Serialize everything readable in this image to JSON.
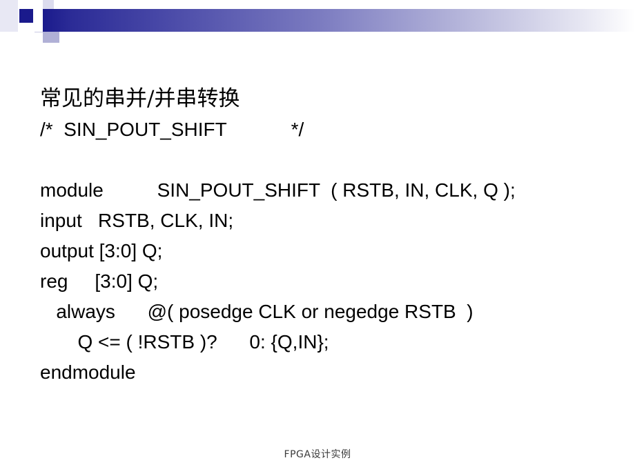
{
  "slide": {
    "title_cn": "常见的串并/并串转换",
    "comment_line": "/*  SIN_POUT_SHIFT            */",
    "code_lines": [
      "module          SIN_POUT_SHIFT  ( RSTB, IN, CLK, Q );",
      "input   RSTB, CLK, IN;",
      "output [3:0] Q;",
      "reg     [3:0] Q;",
      "   always      @( posedge CLK or negedge RSTB  )",
      "       Q <= ( !RSTB )?      0: {Q,IN};",
      "endmodule"
    ],
    "footer_text": "FPGA设计实例"
  },
  "decor": {
    "banner_start_color": "#1a1a8c",
    "banner_end_color": "#ffffff",
    "accent_square_color": "#1a1a8c",
    "text_color": "#000000"
  }
}
